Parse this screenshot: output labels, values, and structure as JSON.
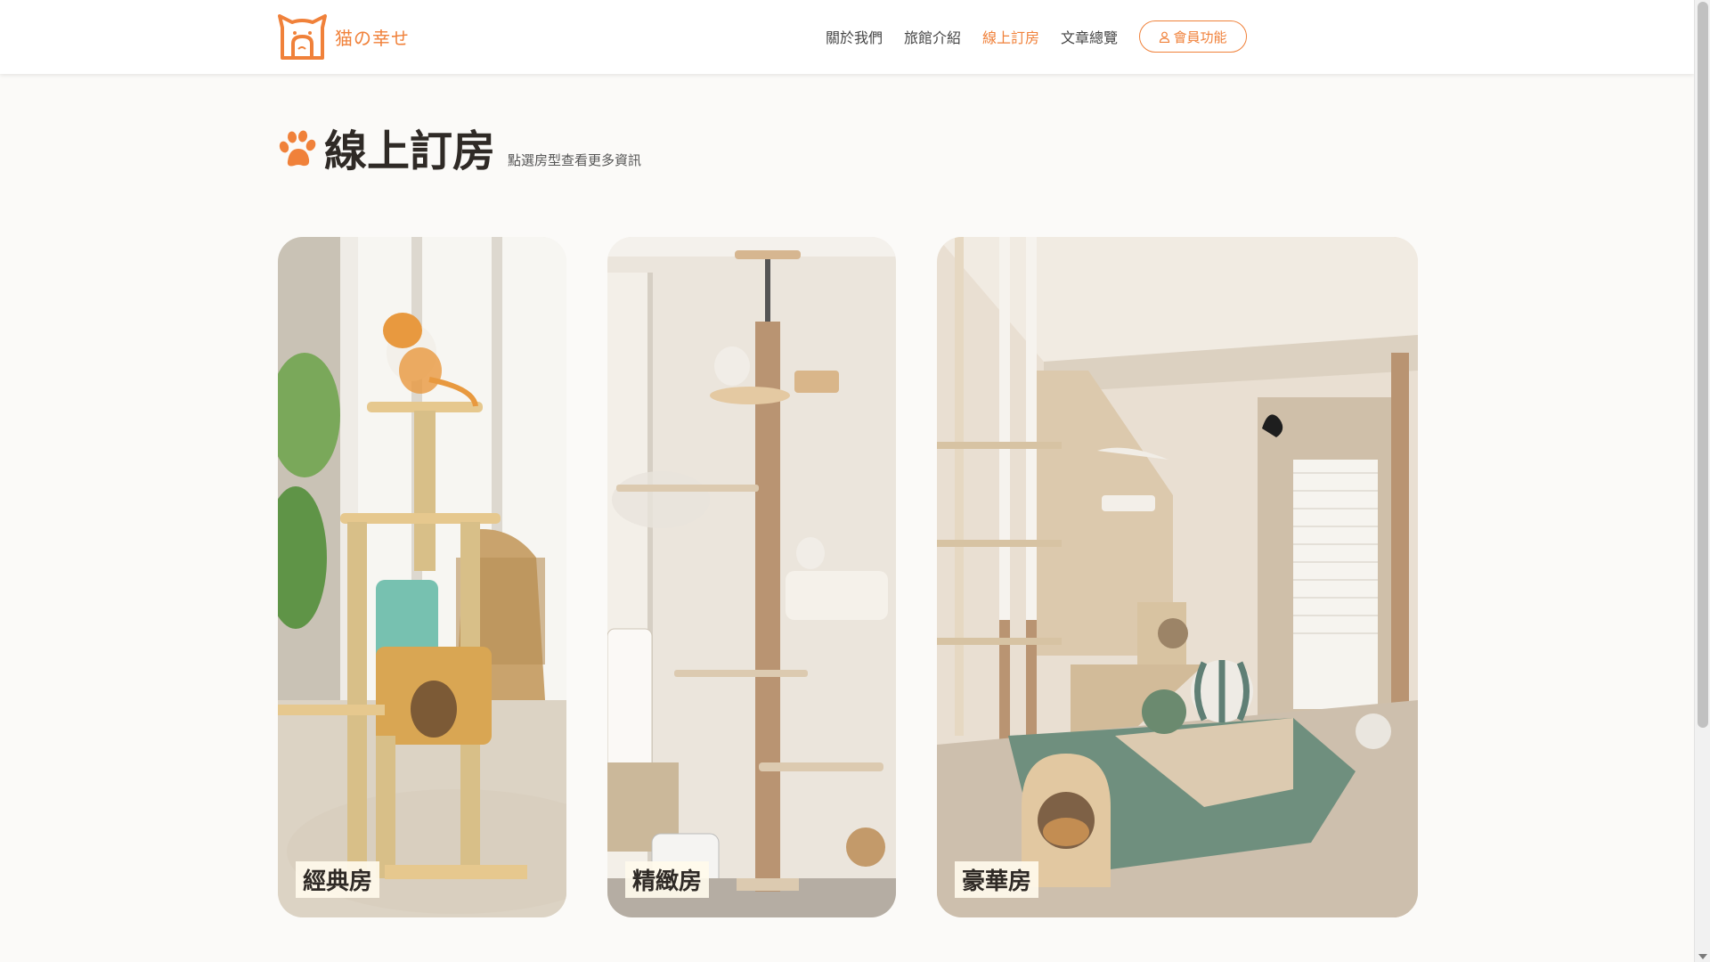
{
  "brand": {
    "name": "猫の幸せ",
    "accent": "#f0813a"
  },
  "nav": {
    "items": [
      {
        "label": "關於我們"
      },
      {
        "label": "旅館介紹"
      },
      {
        "label": "線上訂房"
      },
      {
        "label": "文章總覽"
      }
    ],
    "active_index": 2,
    "member_label": "會員功能",
    "member_icon": "user-icon"
  },
  "page": {
    "title": "線上訂房",
    "subtitle": "點選房型查看更多資訊",
    "title_icon": "paw-icon"
  },
  "rooms": [
    {
      "label": "經典房"
    },
    {
      "label": "精緻房"
    },
    {
      "label": "豪華房"
    }
  ]
}
